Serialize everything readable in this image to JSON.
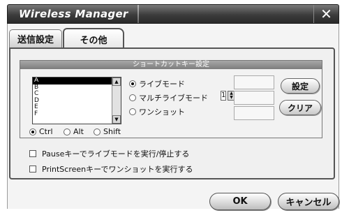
{
  "window": {
    "title": "Wireless Manager",
    "close_glyph": "✕"
  },
  "tabs": [
    {
      "label": "送信設定",
      "active": false
    },
    {
      "label": "その他",
      "active": true
    }
  ],
  "shortcut_group": {
    "title": "ショートカットキー設定",
    "keys": [
      "A",
      "B",
      "C",
      "D",
      "E",
      "F"
    ],
    "selected_key": "A",
    "modifiers": [
      {
        "label": "Ctrl",
        "selected": true
      },
      {
        "label": "Alt",
        "selected": false
      },
      {
        "label": "Shift",
        "selected": false
      }
    ],
    "modes": [
      {
        "label": "ライブモード",
        "selected": true
      },
      {
        "label": "マルチライブモード",
        "selected": false
      },
      {
        "label": "ワンショット",
        "selected": false
      }
    ],
    "multi_count": "1",
    "set_button": "設定",
    "clear_button": "クリア"
  },
  "options": [
    {
      "label": "Pauseキーでライブモードを実行/停止する",
      "checked": false
    },
    {
      "label": "PrintScreenキーでワンショットを実行する",
      "checked": false
    }
  ],
  "footer": {
    "ok": "OK",
    "cancel": "キャンセル"
  }
}
